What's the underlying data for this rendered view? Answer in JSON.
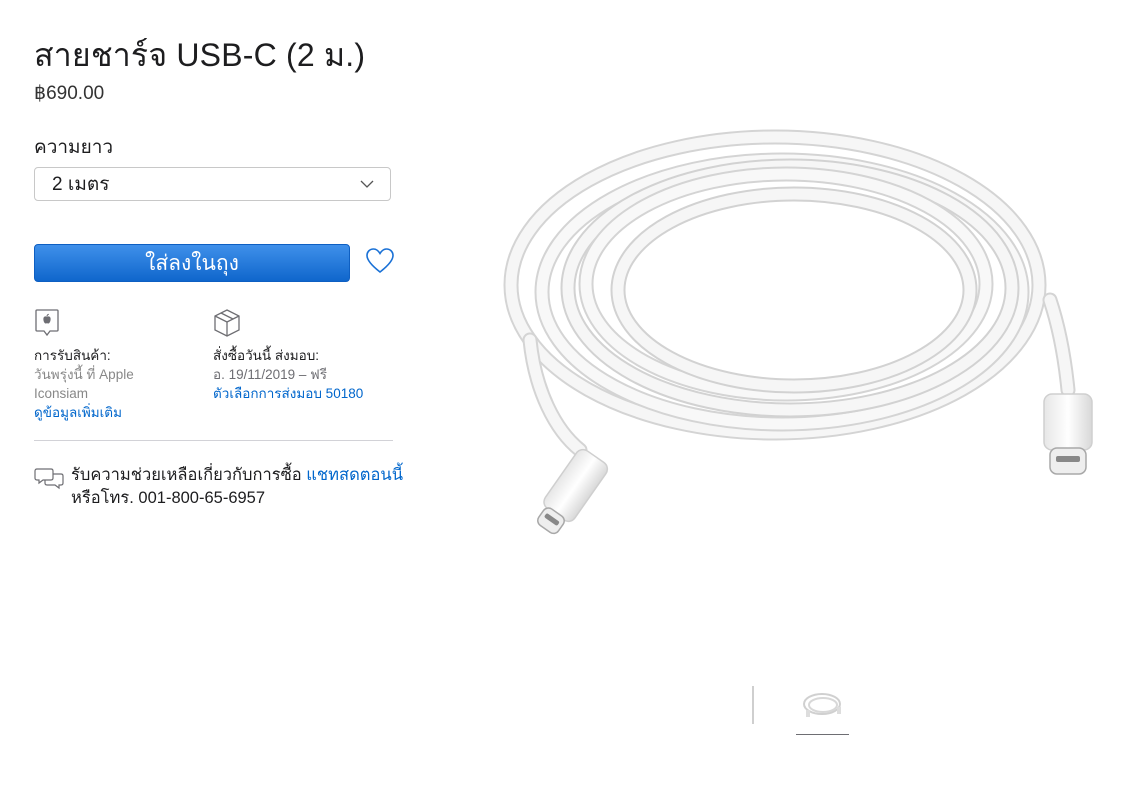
{
  "product": {
    "title": "สายชาร์จ USB-C (2 ม.)",
    "price": "฿690.00"
  },
  "length": {
    "label": "ความยาว",
    "selected": "2 เมตร"
  },
  "actions": {
    "add_to_bag": "ใส่ลงในถุง"
  },
  "pickup": {
    "heading": "การรับสินค้า:",
    "line1": "วันพรุ่งนี้ ที่ Apple",
    "line2": "Iconsiam",
    "link": "ดูข้อมูลเพิ่มเติม"
  },
  "delivery": {
    "heading": "สั่งซื้อวันนี้ ส่งมอบ:",
    "line1": "อ. 19/11/2019 – ฟรี",
    "link": "ตัวเลือกการส่งมอบ 50180"
  },
  "help": {
    "text": "รับความช่วยเหลือเกี่ยวกับการซื้อ",
    "chat_link": "แชทสดตอนนี้",
    "phone": "หรือโทร. 001-800-65-6957"
  },
  "colors": {
    "accent": "#0066cc",
    "button": "#1a71d6"
  },
  "icons": [
    "chevron-down-icon",
    "heart-icon",
    "apple-store-icon",
    "box-icon",
    "chat-icon"
  ]
}
